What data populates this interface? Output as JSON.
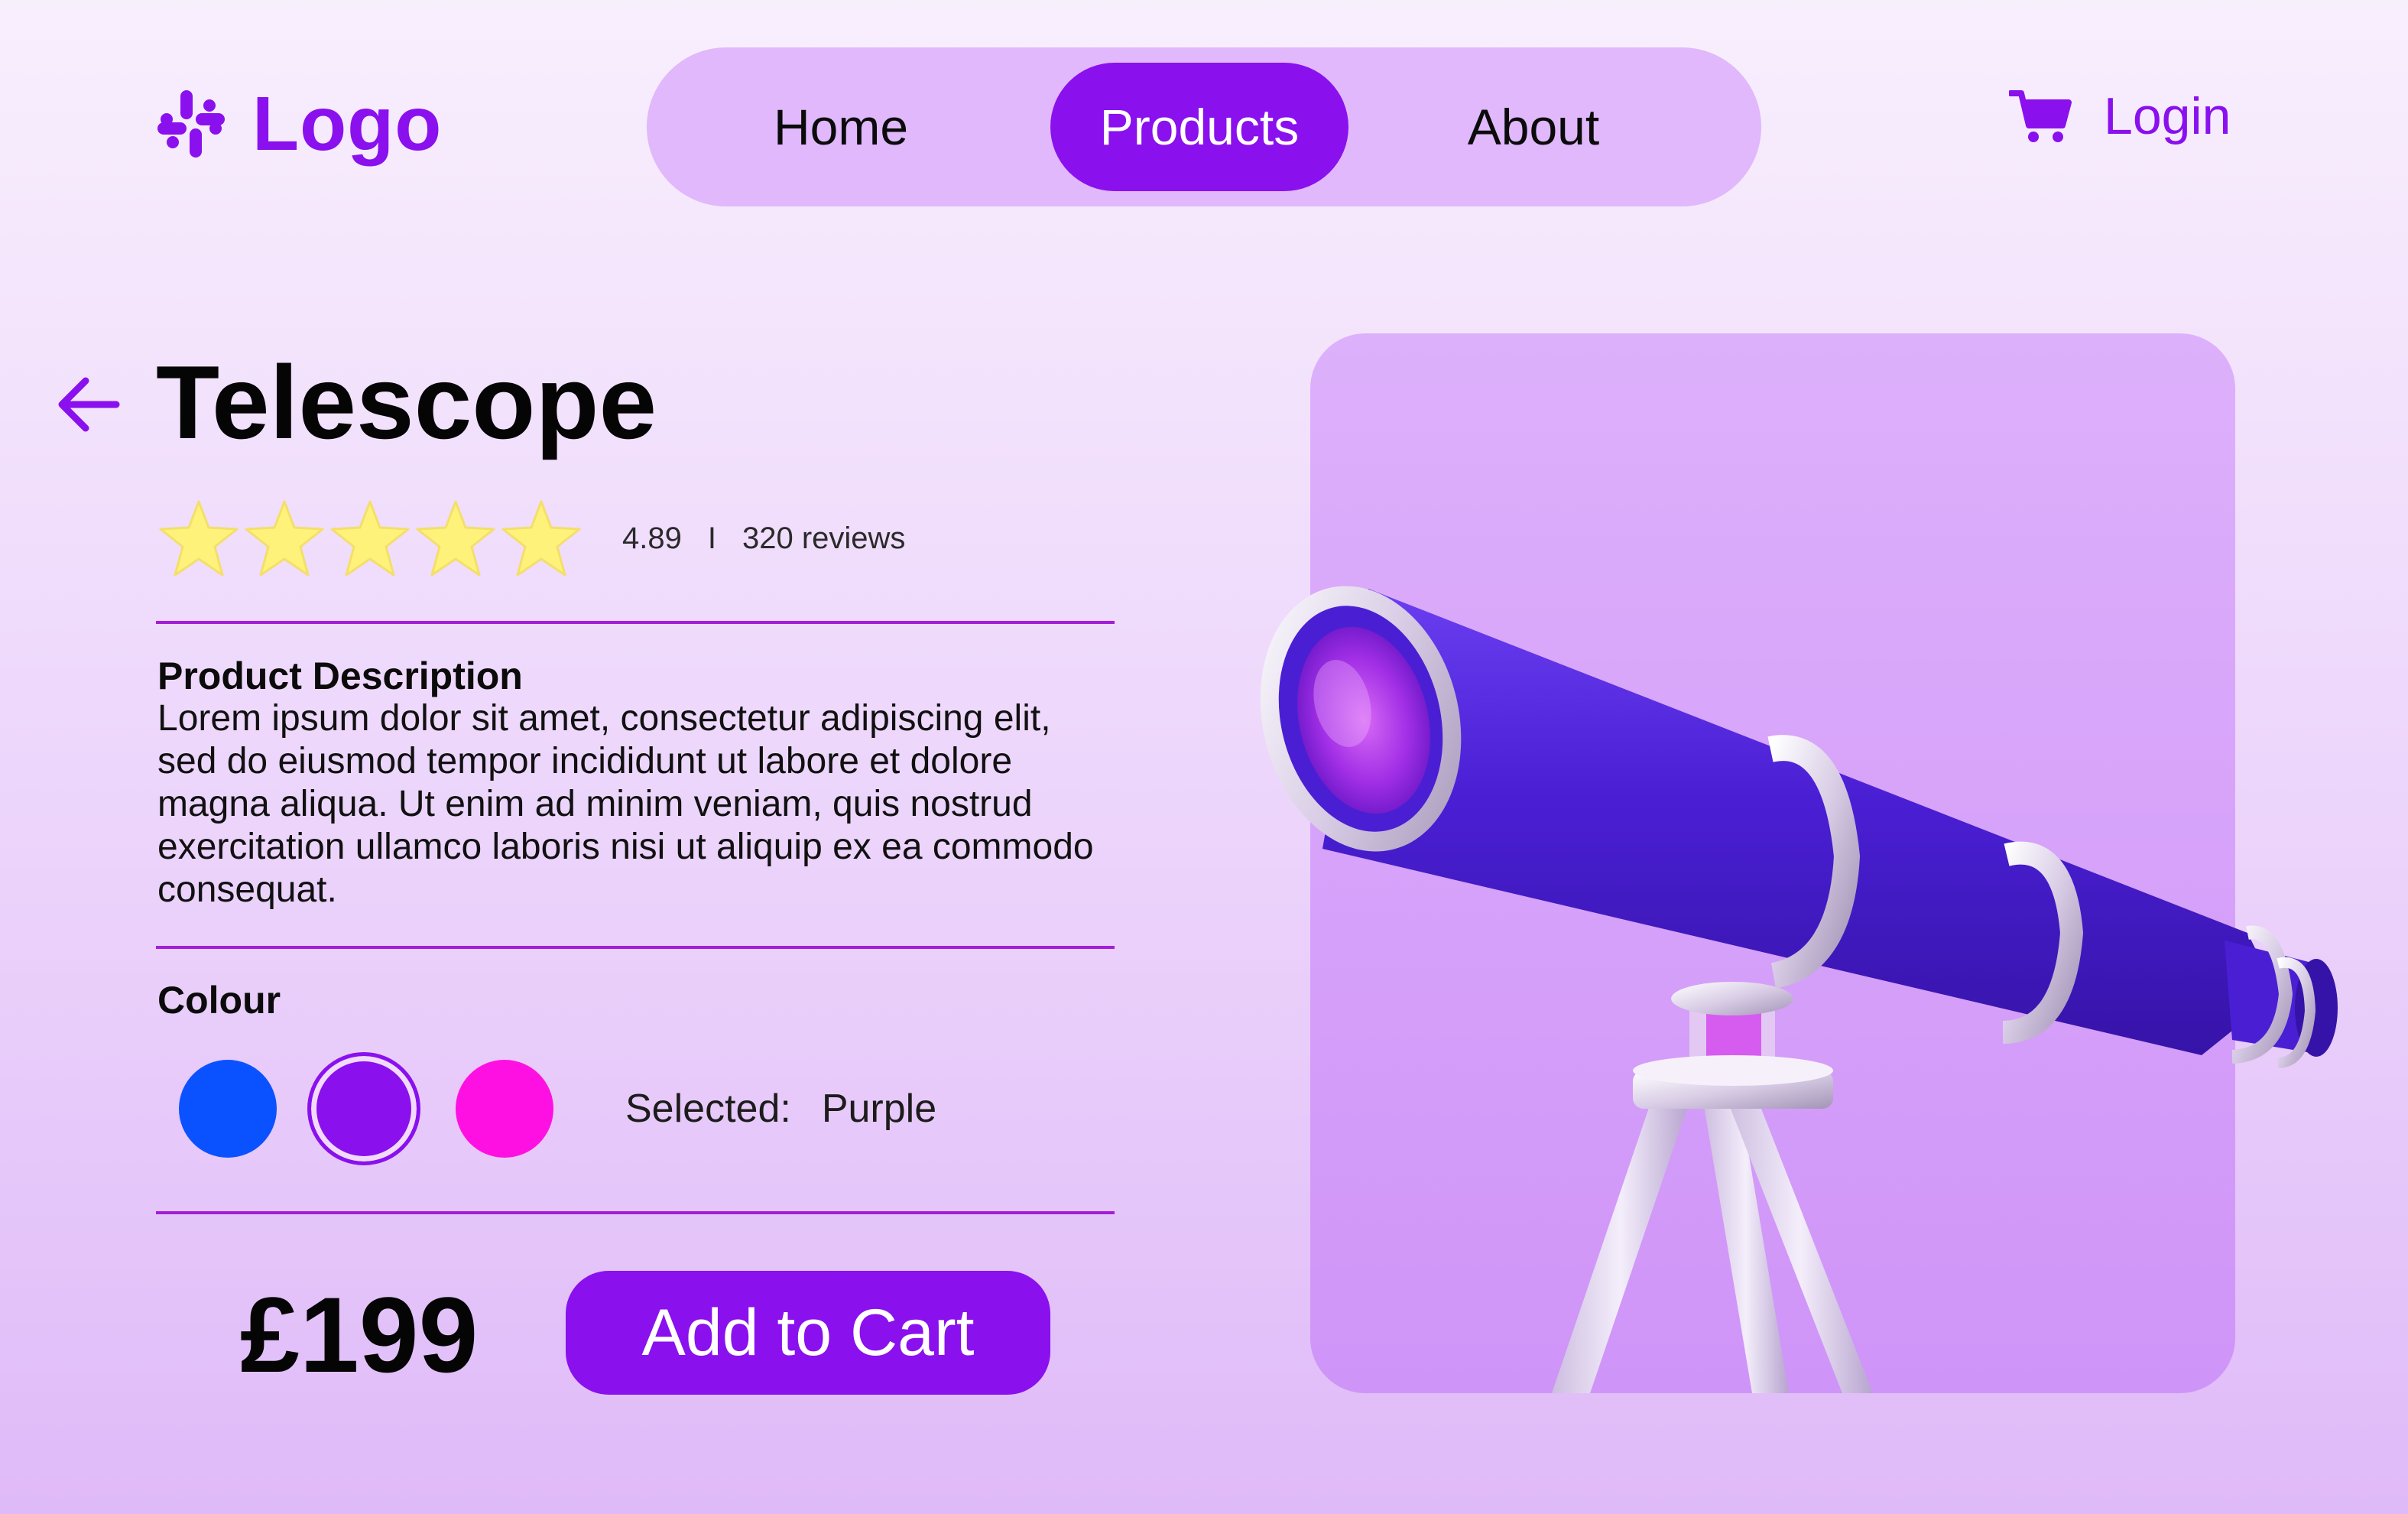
{
  "header": {
    "logo_icon": "slack-logo-icon",
    "logo_text": "Logo",
    "nav": [
      {
        "label": "Home",
        "active": false
      },
      {
        "label": "Products",
        "active": true
      },
      {
        "label": "About",
        "active": false
      }
    ],
    "cart_icon": "shopping-cart-icon",
    "login_label": "Login"
  },
  "product": {
    "back_icon": "arrow-left-icon",
    "title": "Telescope",
    "rating": {
      "stars": 5,
      "value": "4.89",
      "separator": "I",
      "reviews": "320 reviews"
    },
    "description_heading": "Product Description",
    "description": "Lorem ipsum dolor sit amet, consectetur adipiscing elit, sed do eiusmod tempor incididunt ut labore et dolore magna aliqua. Ut enim ad minim veniam, quis nostrud exercitation ullamco laboris nisi ut aliquip ex ea commodo consequat.",
    "colour_heading": "Colour",
    "colours": [
      {
        "name": "Blue",
        "hex": "#0a52ff",
        "selected": false
      },
      {
        "name": "Purple",
        "hex": "#8a10ee",
        "selected": true
      },
      {
        "name": "Magenta",
        "hex": "#ff10e2",
        "selected": false
      }
    ],
    "selected_label": "Selected:",
    "selected_value": "Purple",
    "price": "£199",
    "add_to_cart_label": "Add to Cart"
  },
  "image": {
    "subject": "telescope-illustration"
  },
  "colors": {
    "accent": "#8a10ee",
    "nav_pill": "#e0b8fb",
    "divider": "#a21fd8",
    "star": "#fff27a",
    "card": "#d6a2fa"
  }
}
